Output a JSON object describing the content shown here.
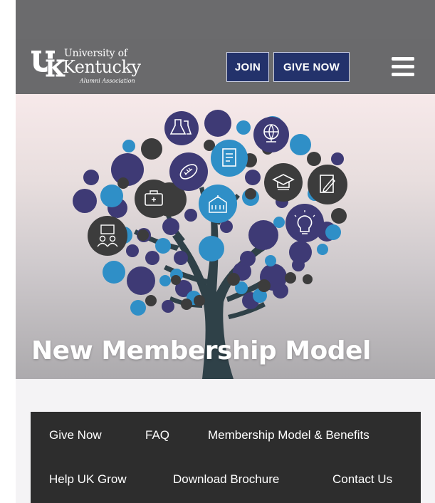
{
  "logo": {
    "line1": "University of",
    "line2": "Kentucky",
    "line3": "Alumni Association"
  },
  "header": {
    "join_label": "JOIN",
    "give_label": "GIVE NOW"
  },
  "hero": {
    "title": "New Membership Model"
  },
  "subnav": {
    "items": [
      {
        "label": "Give Now"
      },
      {
        "label": "FAQ"
      },
      {
        "label": "Membership Model & Benefits"
      },
      {
        "label": "Help UK Grow"
      },
      {
        "label": "Download Brochure"
      },
      {
        "label": "Contact Us"
      }
    ]
  },
  "colors": {
    "button_bg": "#23326b",
    "header_bg": "#6a6a6c",
    "subnav_bg": "#2d2d2d",
    "navy": "#3e3a75",
    "blue": "#2f8fc7",
    "dark_gray": "#3c3c3c"
  },
  "icons": [
    "hamburger-menu-icon",
    "lab-flask-icon",
    "globe-icon",
    "scroll-certificate-icon",
    "football-icon",
    "graduation-cap-icon",
    "pencil-document-icon",
    "briefcase-icon",
    "building-icon",
    "lightbulb-icon",
    "people-meeting-icon"
  ]
}
